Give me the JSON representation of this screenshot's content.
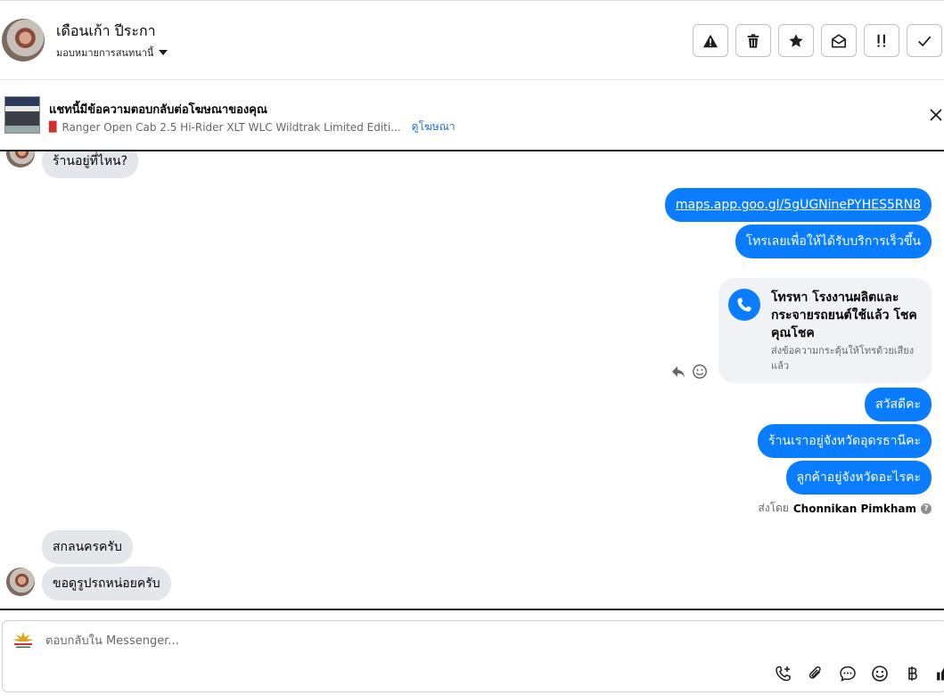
{
  "header": {
    "contact_name": "เดือนเก้า ปีระกา",
    "assign_label": "มอบหมายการสนทนานี้",
    "actions": [
      {
        "name": "spam-button",
        "icon": "warning-icon"
      },
      {
        "name": "delete-button",
        "icon": "trash-icon"
      },
      {
        "name": "star-button",
        "icon": "star-icon"
      },
      {
        "name": "mark-unread-button",
        "icon": "envelope-open-icon"
      },
      {
        "name": "follow-up-button",
        "icon": "exclamation-icon"
      },
      {
        "name": "mark-done-button",
        "icon": "check-icon"
      }
    ]
  },
  "ad": {
    "title": "แชทนี้มีข้อความตอบกลับต่อโฆษณาของคุณ",
    "subtitle": "Ranger Open Cab 2.5 Hi-Rider XLT WLC Wildtrak Limited Editi...",
    "link": "ดูโฆษณา"
  },
  "messages": {
    "m1": "ร้านอยู่ที่ไหน?",
    "m2": "maps.app.goo.gl/5gUGNinePYHES5RN8",
    "m3": "โทรเลยเพื่อให้ได้รับบริการเร็วขึ้น",
    "call_title": "โทรหา โรงงานผลิตและกระจายรถยนต์ใช้แล้ว โชคคุณโชค",
    "call_sub": "ส่งข้อความกระตุ้นให้โทรด้วยเสียงแล้ว",
    "m4": "สวัสดีคะ",
    "m5": "ร้านเราอยู่จังหวัดอุดรธานีคะ",
    "m6": "ลูกค้าอยู่จังหวัดอะไรคะ",
    "sent_by_label": "ส่งโดย",
    "sent_by_name": "Chonnikan Pimkham",
    "m7": "สกลนครครับ",
    "m8": "ขอดูรูปรถหน่อยครับ"
  },
  "composer": {
    "placeholder": "ตอบกลับใน Messenger..."
  },
  "colors": {
    "outgoing": "#0a7cff",
    "incoming": "#e4e6eb",
    "link": "#216fdb"
  }
}
